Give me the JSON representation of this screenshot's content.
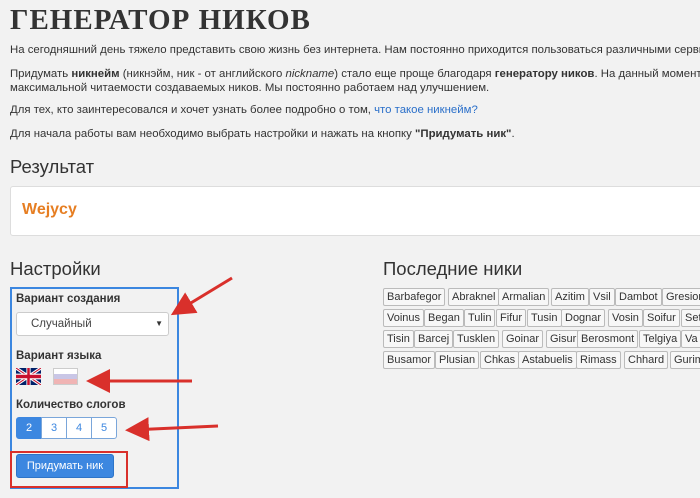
{
  "page": {
    "title": "ГЕНЕРАТОР НИКОВ",
    "intro1": "На сегодняшний день тяжело представить свою жизнь без интернета. Нам постоянно приходится пользоваться различными сервисами",
    "intro2_a": "Придумать ",
    "intro2_b": "никнейм",
    "intro2_c": " (никнэйм, ник - от английского ",
    "intro2_d": "nickname",
    "intro2_e": ") стало еще проще благодаря ",
    "intro2_f": "генератору ников",
    "intro2_g": ". На данный момент ва",
    "intro2_line2": "максимальной читаемости создаваемых ников. Мы постоянно работаем над улучшением.",
    "intro3_a": "Для тех, кто заинтересовался и хочет узнать более подробно о том, ",
    "intro3_link": "что такое никнейм?",
    "intro4_a": "Для начала работы вам необходимо выбрать настройки и нажать на кнопку ",
    "intro4_b": "\"Придумать ник\"",
    "intro4_c": "."
  },
  "result": {
    "heading": "Результат",
    "nick": "Wejycy",
    "nick_color": "#e67e22"
  },
  "settings": {
    "heading": "Настройки",
    "creation_label": "Вариант создания",
    "creation_value": "Случайный",
    "language_label": "Вариант языка",
    "flags": [
      "uk-flag-icon",
      "ru-flag-icon"
    ],
    "syllables_label": "Количество слогов",
    "syllables": [
      "2",
      "3",
      "4",
      "5"
    ],
    "syllables_selected": "2",
    "submit_label": "Придумать ник",
    "accent": "#3c87e0"
  },
  "recent": {
    "heading": "Последние ники",
    "rows": [
      [
        "Barbafegor",
        "Abraknel",
        "Armalian",
        "Azitim",
        "Vsil",
        "Dambot",
        "Gresion"
      ],
      [
        "Voinus",
        "Began",
        "Tulin",
        "Fifur",
        "Tusin",
        "Dognar",
        "Vosin",
        "Soifur",
        "Set"
      ],
      [
        "Tisin",
        "Barcej",
        "Tusklen",
        "Goinar",
        "Gisur",
        "Berosmont",
        "Telgiya",
        "Va"
      ],
      [
        "Busamor",
        "Plusian",
        "Chkas",
        "Astabuelis",
        "Rimass",
        "Chhard",
        "Gurim"
      ]
    ]
  },
  "annotation_color": "#d9302b"
}
